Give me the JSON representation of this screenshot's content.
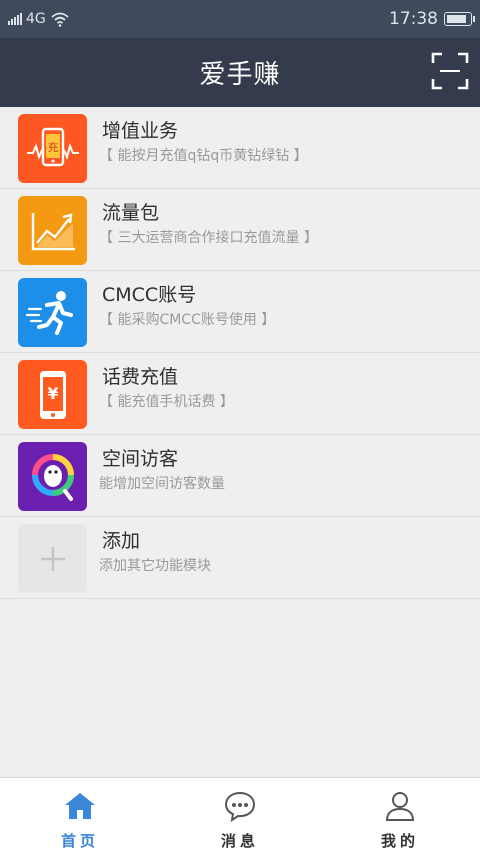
{
  "status_bar": {
    "network": "4G",
    "time": "17:38",
    "battery_level": 0.85
  },
  "header": {
    "title": "爱手赚",
    "scan_icon": "scan-frame-icon"
  },
  "services": [
    {
      "icon": "phone-recharge-icon",
      "title": "增值业务",
      "desc": "【 能按月充值q钻q币黄钻绿钻 】",
      "color": "#ff5722"
    },
    {
      "icon": "chart-growth-icon",
      "title": "流量包",
      "desc": "【 三大运营商合作接口充值流量 】",
      "color": "#f39a12"
    },
    {
      "icon": "running-man-icon",
      "title": "CMCC账号",
      "desc": "【 能采购CMCC账号使用 】",
      "color": "#1e8fe8"
    },
    {
      "icon": "phone-yuan-icon",
      "title": "话费充值",
      "desc": "【 能充值手机话费 】",
      "color": "#ff5a1f"
    },
    {
      "icon": "qq-penguin-icon",
      "title": "空间访客",
      "desc": "能增加空间访客数量",
      "color": "#6a1fb0"
    },
    {
      "icon": "plus-icon",
      "title": "添加",
      "desc": "添加其它功能模块",
      "color": "#e6e6e6"
    }
  ],
  "tabs": [
    {
      "icon": "home-icon",
      "label": "首页",
      "active": true
    },
    {
      "icon": "chat-bubble-icon",
      "label": "消息",
      "active": false
    },
    {
      "icon": "user-icon",
      "label": "我的",
      "active": false
    }
  ],
  "colors": {
    "status_bar": "#3f4a5c",
    "header": "#333b4d",
    "active_tab": "#3a86d9"
  }
}
